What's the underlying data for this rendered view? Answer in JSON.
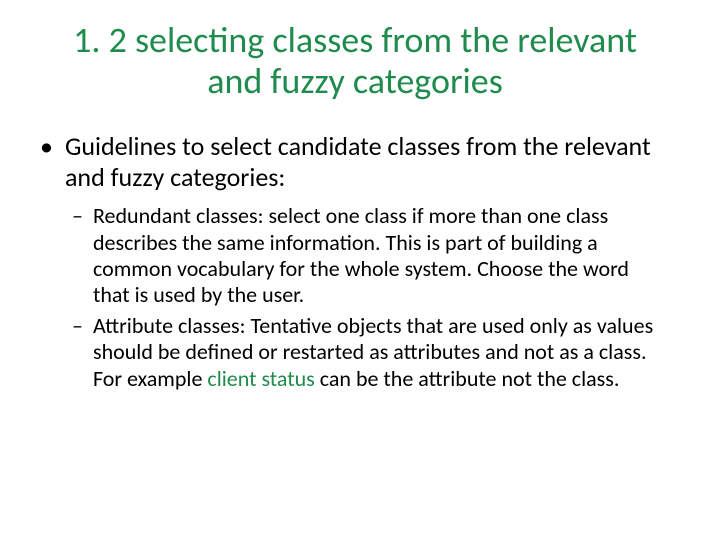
{
  "title": "1. 2 selecting classes from the relevant and fuzzy categories",
  "bullet": {
    "marker": "•",
    "text": "Guidelines to select candidate classes from the relevant and fuzzy categories:"
  },
  "sub": [
    {
      "marker": "–",
      "prefix": "Redundant classes: ",
      "text": "select one class if more than one class describes the same information. This is part of building a common vocabulary for the whole system. Choose the word that is used by the user."
    },
    {
      "marker": "–",
      "prefix": "Attribute classes: ",
      "text_before": "Tentative objects that are used only as values should be defined or restarted as attributes and not as a class. For example ",
      "highlight": "client status ",
      "text_after": "can be the attribute not the class."
    }
  ]
}
